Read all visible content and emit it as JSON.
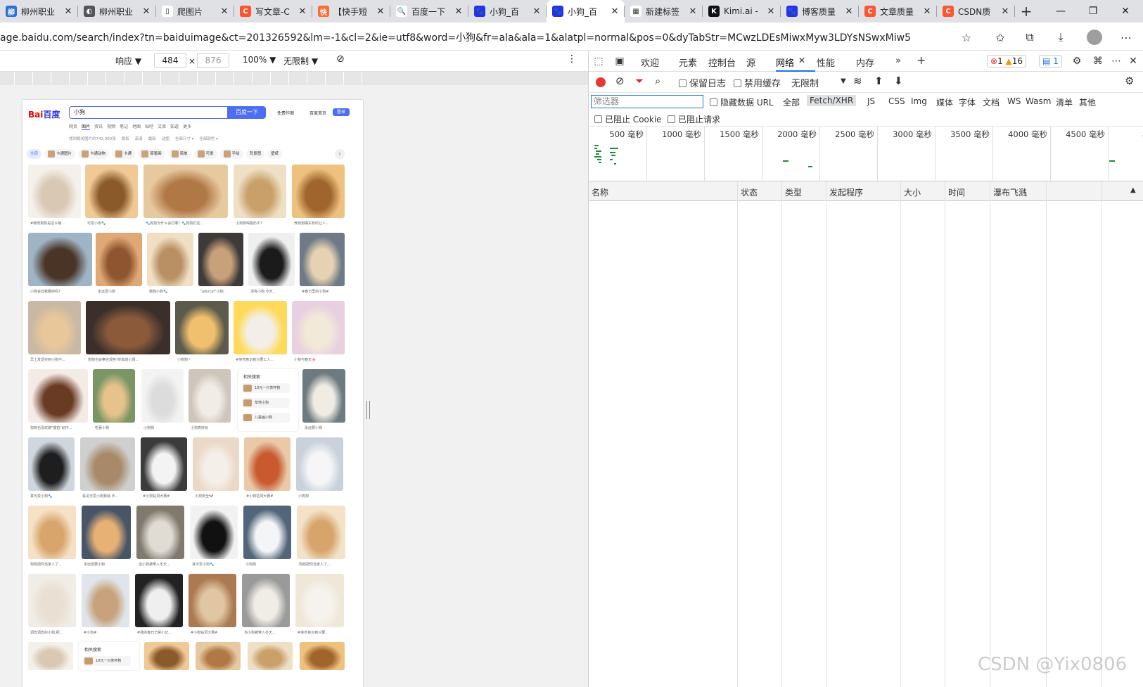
{
  "browser": {
    "tabs": [
      {
        "title": "柳州职业",
        "color": "#2f6fd6",
        "glyph": "柳"
      },
      {
        "title": "柳州职业",
        "color": "#555555",
        "glyph": "◐"
      },
      {
        "title": "爬图片",
        "color": "#ffffff",
        "glyph": "▯"
      },
      {
        "title": "写文章-C",
        "color": "#fc5531",
        "glyph": "C"
      },
      {
        "title": "【快手短",
        "color": "#ff6b35",
        "glyph": "快"
      },
      {
        "title": "百度一下",
        "color": "#ffffff",
        "glyph": "🔍"
      },
      {
        "title": "小狗_百",
        "color": "#2932e1",
        "glyph": "🐾"
      },
      {
        "title": "小狗_百",
        "color": "#2932e1",
        "glyph": "🐾"
      },
      {
        "title": "新建标签",
        "color": "#ffffff",
        "glyph": "▦"
      },
      {
        "title": "Kimi.ai -",
        "color": "#111111",
        "glyph": "K"
      },
      {
        "title": "博客质量",
        "color": "#2932e1",
        "glyph": "🐾"
      },
      {
        "title": "文章质量",
        "color": "#fc5531",
        "glyph": "C"
      },
      {
        "title": "CSDN质",
        "color": "#fc5531",
        "glyph": "C"
      }
    ],
    "active_tab_index": 7,
    "new_tab": "+",
    "url": "age.baidu.com/search/index?tn=baiduimage&ct=201326592&lm=-1&cl=2&ie=utf8&word=小狗&fr=ala&ala=1&alatpl=normal&pos=0&dyTabStr=MCwzLDEsMiwxMyw3LDYsNSwxMiw5",
    "window_controls": {
      "minimize": "—",
      "restore": "❐",
      "close": "✕"
    },
    "address_icons": [
      "star-plus-icon",
      "favorites-icon",
      "collections-icon",
      "downloads-icon",
      "profile-icon",
      "more-icon"
    ]
  },
  "emulation": {
    "mode": "响应 ▼",
    "width": "484",
    "times": "×",
    "height": "876",
    "zoom": "100% ▼",
    "throttle": "无限制 ▼",
    "rotate_icon": "rotate-icon",
    "more": "⋮"
  },
  "baidu": {
    "logo": "Bai",
    "logo2": "百度",
    "query": "小狗",
    "search_btn": "百度一下",
    "right_links": [
      "免费作图",
      "百度首页"
    ],
    "login": "登录",
    "nav": [
      "网页",
      "图片",
      "资讯",
      "视频",
      "笔记",
      "地图",
      "贴吧",
      "文库",
      "知道",
      "更多"
    ],
    "nav_active": 1,
    "filters": [
      "找到相关图片约742,000张",
      "版权",
      "高清",
      "最新",
      "动图",
      "全部尺寸 ▾",
      "全部颜色 ▾"
    ],
    "chips": [
      "全部",
      "卡通图片",
      "卡通动物",
      "卡通",
      "简笔画",
      "简单",
      "可爱",
      "手绘",
      "背景图",
      "壁纸"
    ],
    "chip_next": "›",
    "captions": [
      "#萌宠狗狗是这么萌...",
      "可爱小狗🐾",
      "🐾狗狗为什么会打哪？🐾狗狗们这...",
      "小狗狗喝酸奶不?",
      "养狗狗确实有时让人...",
      "小狗会向我撒娇吗?",
      "永远爱小狗",
      "做狗小狗🐾",
      "\"jellycat\"小狗",
      "漂亮小狗,今天...",
      "#春日里的小狗#",
      "早上发现买到小狗不...",
      "狗狗也会察言观色?你知道心情...",
      "小狗狗~",
      "#突然意识到只要工人...",
      "小狗与春天🌸",
      "狗狗也喜欢做\"摆拍\"动作...",
      "吃著小狗",
      "小狗狗",
      "小狗真好玩",
      "永远要小狗",
      "真可爱小狗🐾",
      "看见可爱小狗我就,手...",
      "#小狗钻洞大赛#",
      "小狗安全🐶",
      "#小狗钻洞大赛#",
      "小狗狗",
      "狗狗把你当家人了...",
      "永远需要小狗",
      "当小狗被带入冬天...",
      "真可爱小狗🐾",
      "小狗狗",
      "狗狗把你当家人了...",
      "调皮调皮的小狗,把...",
      "#小狗#",
      "#我的春日日常小记...",
      "#小狗钻洞大赛#",
      "当小狗被带入冬天...",
      "#突然意识到只要..."
    ],
    "related_title": "相关搜索",
    "related": [
      "10元一只茶杯狗",
      "草地小狗",
      "儿童画小狗"
    ],
    "related_title_2": "相关搜索",
    "related_2": [
      "10元一只茶杯狗"
    ]
  },
  "devtools": {
    "tabs": [
      "欢迎",
      "元素",
      "控制台",
      "源",
      "网络",
      "性能",
      "内存"
    ],
    "active_tab": "网络",
    "more_tabs": "»",
    "add_tab": "+",
    "errors": "1",
    "warnings": "16",
    "messages": "1",
    "network_toolbar": {
      "preserve_log": "保留日志",
      "disable_cache": "禁用缓存",
      "throttle": "无限制",
      "throttle_arrow": "▼"
    },
    "filter_placeholder": "筛选器",
    "filter_options": [
      "隐藏数据 URL",
      "全部",
      "Fetch/XHR",
      "JS",
      "CSS",
      "Img",
      "媒体",
      "字体",
      "文档",
      "WS",
      "Wasm",
      "清单",
      "其他"
    ],
    "filter_active": "Fetch/XHR",
    "blocked_cookies": "已阻止 Cookie",
    "blocked_requests": "已阻止请求",
    "timeline_labels": [
      "500 毫秒",
      "1000 毫秒",
      "1500 毫秒",
      "2000 毫秒",
      "2500 毫秒",
      "3000 毫秒",
      "3500 毫秒",
      "4000 毫秒",
      "4500 毫秒",
      "5000"
    ],
    "columns": [
      "名称",
      "状态",
      "类型",
      "发起程序",
      "大小",
      "时间",
      "瀑布飞溅"
    ],
    "sort_arrow": "▲"
  },
  "watermark": "CSDN @Yix0806",
  "colors": {
    "accent": "#1a73e8",
    "baidu_blue": "#4e6ef2",
    "record_red": "#e53935",
    "timeline_green": "#1e8e3e"
  }
}
